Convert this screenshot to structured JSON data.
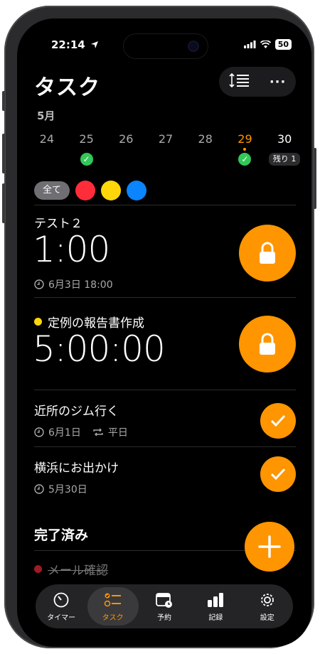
{
  "status": {
    "time": "22:14",
    "battery": "50"
  },
  "header": {
    "title": "タスク",
    "more_label": "···"
  },
  "calendar": {
    "month": "5月",
    "days": [
      {
        "label": "24"
      },
      {
        "label": "25",
        "badge": "check"
      },
      {
        "label": "26"
      },
      {
        "label": "27"
      },
      {
        "label": "28"
      },
      {
        "label": "29",
        "badge": "check",
        "today": true
      },
      {
        "label": "30",
        "remain": "残り 1"
      }
    ]
  },
  "filters": {
    "all_label": "全て",
    "colors": [
      "#ff2d3a",
      "#ffd60a",
      "#0a84ff"
    ]
  },
  "tasks": [
    {
      "name": "テスト２",
      "big": "1:00",
      "meta": "6月3日 18:00",
      "action": "lock"
    },
    {
      "name": "定例の報告書作成",
      "dot": "#ffd60a",
      "big": "5:00:00",
      "action": "lock"
    },
    {
      "name": "近所のジム行く",
      "meta": "6月1日",
      "repeat": "平日",
      "action": "check"
    },
    {
      "name": "横浜にお出かけ",
      "meta": "5月30日",
      "action": "check"
    }
  ],
  "completed": {
    "title": "完了済み",
    "items": [
      {
        "name": "メール確認",
        "dot": "#ff2d3a"
      }
    ]
  },
  "tabs": [
    {
      "label": "タイマー",
      "icon": "timer-icon"
    },
    {
      "label": "タスク",
      "icon": "task-list-icon",
      "active": true
    },
    {
      "label": "予約",
      "icon": "calendar-clock-icon"
    },
    {
      "label": "記録",
      "icon": "bar-chart-icon"
    },
    {
      "label": "設定",
      "icon": "gear-icon"
    }
  ],
  "colors": {
    "accent": "#ff9500",
    "success": "#32c759"
  }
}
